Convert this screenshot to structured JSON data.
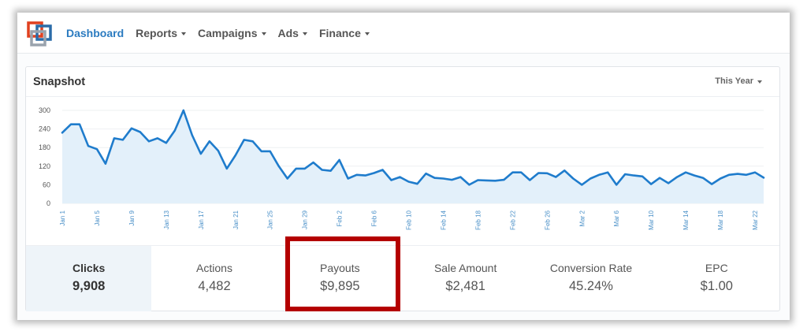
{
  "nav": {
    "items": [
      {
        "label": "Dashboard",
        "active": true,
        "has_caret": false
      },
      {
        "label": "Reports",
        "active": false,
        "has_caret": true
      },
      {
        "label": "Campaigns",
        "active": false,
        "has_caret": true
      },
      {
        "label": "Ads",
        "active": false,
        "has_caret": true
      },
      {
        "label": "Finance",
        "active": false,
        "has_caret": true
      }
    ],
    "logo_icon": "stacked-squares-logo-icon"
  },
  "panel": {
    "title": "Snapshot",
    "period_label": "This Year"
  },
  "stats": [
    {
      "label": "Clicks",
      "value": "9,908",
      "selected": true
    },
    {
      "label": "Actions",
      "value": "4,482",
      "selected": false
    },
    {
      "label": "Payouts",
      "value": "$9,895",
      "selected": false
    },
    {
      "label": "Sale Amount",
      "value": "$2,481",
      "selected": false
    },
    {
      "label": "Conversion Rate",
      "value": "45.24%",
      "selected": false
    },
    {
      "label": "EPC",
      "value": "$1.00",
      "selected": false
    }
  ],
  "colors": {
    "accent": "#2b7bc0",
    "line": "#1f7ccc",
    "area": "#e3f0fa",
    "highlight": "#b40000",
    "selected_bg": "#eef4f9"
  },
  "chart_data": {
    "type": "area",
    "yticks": [
      0,
      60,
      120,
      180,
      240,
      300
    ],
    "ylim": [
      0,
      300
    ],
    "xtick_labels": [
      "Jan 1",
      "Jan 5",
      "Jan 9",
      "Jan 13",
      "Jan 17",
      "Jan 21",
      "Jan 25",
      "Jan 29",
      "Feb 2",
      "Feb 6",
      "Feb 10",
      "Feb 14",
      "Feb 18",
      "Feb 22",
      "Feb 26",
      "Mar 2",
      "Mar 6",
      "Mar 10",
      "Mar 14",
      "Mar 18",
      "Mar 22"
    ],
    "xtick_step_days": 4,
    "series": [
      {
        "values": [
          228,
          255,
          255,
          185,
          175,
          128,
          210,
          205,
          242,
          230,
          200,
          210,
          195,
          235,
          300,
          220,
          160,
          200,
          170,
          112,
          155,
          205,
          200,
          168,
          168,
          120,
          80,
          112,
          112,
          132,
          108,
          105,
          140,
          80,
          92,
          90,
          98,
          108,
          75,
          85,
          70,
          63,
          96,
          82,
          80,
          76,
          85,
          60,
          75,
          74,
          73,
          76,
          100,
          100,
          75,
          98,
          97,
          85,
          106,
          80,
          60,
          80,
          92,
          100,
          60,
          94,
          90,
          87,
          62,
          82,
          65,
          85,
          100,
          90,
          82,
          62,
          80,
          92,
          95,
          92,
          100,
          83
        ]
      }
    ]
  }
}
